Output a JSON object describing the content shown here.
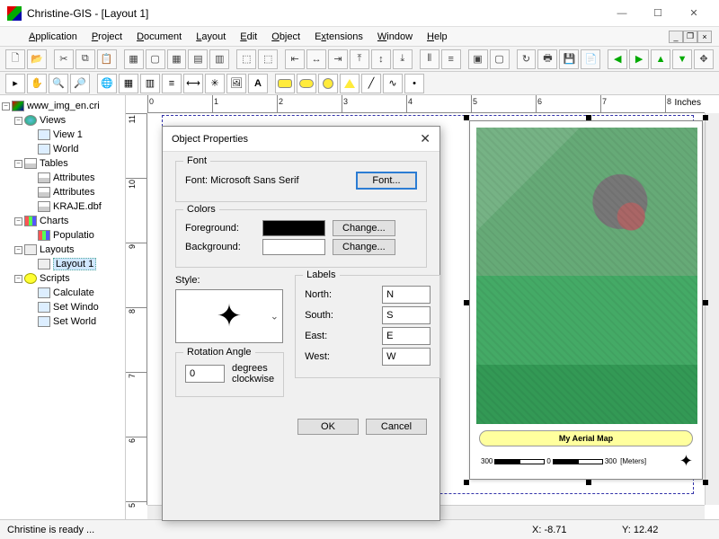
{
  "window": {
    "title": "Christine-GIS - [Layout 1]"
  },
  "menu": {
    "application": "Application",
    "project": "Project",
    "document": "Document",
    "layout": "Layout",
    "edit": "Edit",
    "object": "Object",
    "extensions": "Extensions",
    "window": "Window",
    "help": "Help"
  },
  "ruler": {
    "unit_label": "Inches"
  },
  "tree": {
    "root": "www_img_en.cri",
    "views": "Views",
    "view1": "View 1",
    "world": "World",
    "tables": "Tables",
    "attributes1": "Attributes",
    "attributes2": "Attributes",
    "kraje": "KRAJE.dbf",
    "charts": "Charts",
    "population": "Populatio",
    "layouts": "Layouts",
    "layout1": "Layout 1",
    "scripts": "Scripts",
    "calc": "Calculate",
    "setwnd": "Set Windo",
    "setworld": "Set World"
  },
  "map": {
    "title": "My Aerial Map",
    "scale": {
      "left": "300",
      "mid": "0",
      "right": "300",
      "unit": "[Meters]"
    }
  },
  "dialog": {
    "title": "Object Properties",
    "font_group": "Font",
    "font_label": "Font: Microsoft Sans Serif",
    "font_btn": "Font...",
    "colors_group": "Colors",
    "foreground": "Foreground:",
    "background": "Background:",
    "change": "Change...",
    "style_label": "Style:",
    "rotation_group": "Rotation Angle",
    "rotation_value": "0",
    "rotation_suffix1": "degrees",
    "rotation_suffix2": "clockwise",
    "labels_group": "Labels",
    "north_l": "North:",
    "north_v": "N",
    "south_l": "South:",
    "south_v": "S",
    "east_l": "East:",
    "east_v": "E",
    "west_l": "West:",
    "west_v": "W",
    "ok": "OK",
    "cancel": "Cancel"
  },
  "status": {
    "msg": "Christine is ready ...",
    "x_label": "X: ",
    "x_val": "-8.71",
    "y_label": "Y: ",
    "y_val": "12.42"
  }
}
